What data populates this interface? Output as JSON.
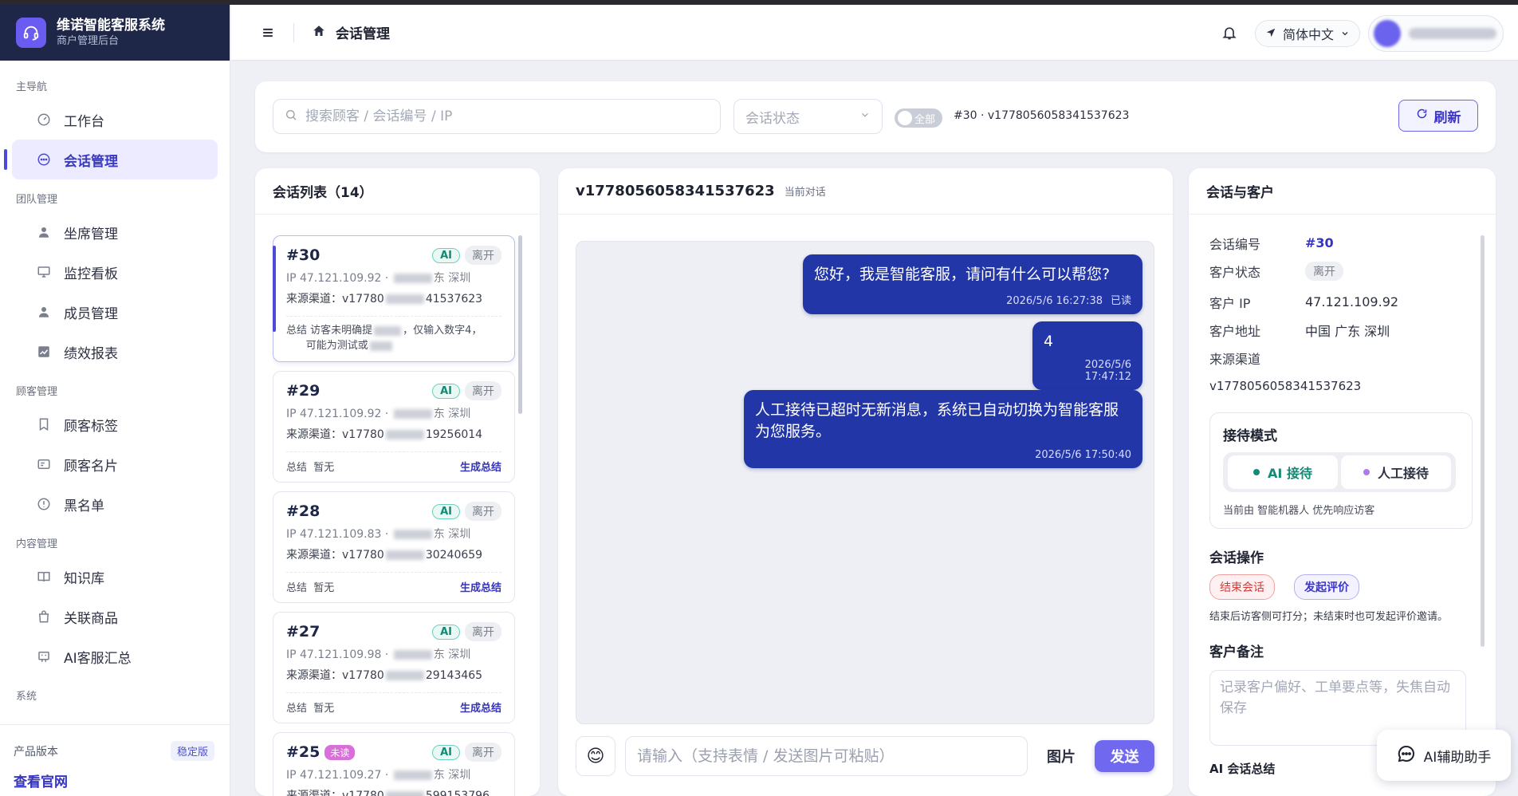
{
  "brand": {
    "name": "维诺智能客服系统",
    "subtitle": "商户管理后台"
  },
  "sidebar": {
    "groups": [
      {
        "label": "主导航",
        "items": [
          {
            "label": "工作台",
            "icon": "dashboard-icon"
          },
          {
            "label": "会话管理",
            "icon": "chat-icon",
            "active": true
          }
        ]
      },
      {
        "label": "团队管理",
        "items": [
          {
            "label": "坐席管理",
            "icon": "user-icon"
          },
          {
            "label": "监控看板",
            "icon": "monitor-icon"
          },
          {
            "label": "成员管理",
            "icon": "user-icon"
          },
          {
            "label": "绩效报表",
            "icon": "chart-icon"
          }
        ]
      },
      {
        "label": "顾客管理",
        "items": [
          {
            "label": "顾客标签",
            "icon": "bookmark-icon"
          },
          {
            "label": "顾客名片",
            "icon": "card-icon"
          },
          {
            "label": "黑名单",
            "icon": "block-icon"
          }
        ]
      },
      {
        "label": "内容管理",
        "items": [
          {
            "label": "知识库",
            "icon": "book-icon"
          },
          {
            "label": "关联商品",
            "icon": "bag-icon"
          },
          {
            "label": "AI客服汇总",
            "icon": "bot-icon"
          }
        ]
      },
      {
        "label": "系统",
        "items": []
      }
    ],
    "footer": {
      "version_label": "产品版本",
      "version_badge": "稳定版",
      "site_link": "查看官网"
    }
  },
  "topbar": {
    "title": "会话管理",
    "language": "简体中文"
  },
  "filters": {
    "search_placeholder": "搜索顾客 / 会话编号 / IP",
    "status_placeholder": "会话状态",
    "toggle_label": "全部",
    "current_session": "#30 · v1778056058341537623",
    "refresh_label": "刷新"
  },
  "session_list": {
    "title": "会话列表（14）",
    "items": [
      {
        "no": "#30",
        "ai": "AI",
        "status": "离开",
        "unread": "",
        "ip_prefix": "IP 47.121.109.92 · ",
        "city": "东 深圳",
        "channel_prefix": "来源渠道：v17780",
        "channel_suffix": "41537623",
        "summary_label": "总结",
        "summary_a": "访客未明确提",
        "summary_b": "，仅输入数字4，",
        "summary_c": "可能为测试或",
        "generate": ""
      },
      {
        "no": "#29",
        "ai": "AI",
        "status": "离开",
        "unread": "",
        "ip_prefix": "IP 47.121.109.92 · ",
        "city": "东 深圳",
        "channel_prefix": "来源渠道：v17780",
        "channel_suffix": "19256014",
        "summary_label": "总结",
        "summary_a": "暂无",
        "generate": "生成总结"
      },
      {
        "no": "#28",
        "ai": "AI",
        "status": "离开",
        "unread": "",
        "ip_prefix": "IP 47.121.109.83 · ",
        "city": "东 深圳",
        "channel_prefix": "来源渠道：v17780",
        "channel_suffix": "30240659",
        "summary_label": "总结",
        "summary_a": "暂无",
        "generate": "生成总结"
      },
      {
        "no": "#27",
        "ai": "AI",
        "status": "离开",
        "unread": "",
        "ip_prefix": "IP 47.121.109.98 · ",
        "city": "东 深圳",
        "channel_prefix": "来源渠道：v17780",
        "channel_suffix": "29143465",
        "summary_label": "总结",
        "summary_a": "暂无",
        "generate": "生成总结"
      },
      {
        "no": "#25",
        "ai": "AI",
        "status": "离开",
        "unread": "未读",
        "ip_prefix": "IP 47.121.109.27 · ",
        "city": "东 深圳",
        "channel_prefix": "来源渠道：v17780",
        "channel_suffix": "599153796",
        "summary_label": "",
        "summary_a": "",
        "generate": ""
      }
    ]
  },
  "chat": {
    "title": "v1778056058341537623",
    "subtitle": "当前对话",
    "messages": [
      {
        "text": "您好，我是智能客服，请问有什么可以帮您?",
        "time": "2026/5/6 16:27:38",
        "read": "已读"
      },
      {
        "text": "4",
        "time": "2026/5/6 17:47:12",
        "read": ""
      },
      {
        "text": "人工接待已超时无新消息，系统已自动切换为智能客服为您服务。",
        "time": "2026/5/6 17:50:40",
        "read": ""
      }
    ],
    "input_placeholder": "请输入（支持表情 / 发送图片可粘贴）",
    "image_label": "图片",
    "send_label": "发送"
  },
  "info": {
    "title": "会话与客户",
    "fields": {
      "session_no_label": "会话编号",
      "session_no": "#30",
      "status_label": "客户状态",
      "status": "离开",
      "ip_label": "客户 IP",
      "ip": "47.121.109.92",
      "address_label": "客户地址",
      "address": "中国 广东 深圳",
      "channel_label": "来源渠道",
      "channel": "v1778056058341537623"
    },
    "mode": {
      "title": "接待模式",
      "ai_label": "AI 接待",
      "human_label": "人工接待",
      "note": "当前由 智能机器人 优先响应访客"
    },
    "ops": {
      "title": "会话操作",
      "end_label": "结束会话",
      "rate_label": "发起评价",
      "note": "结束后访客侧可打分；未结束时也可发起评价邀请。"
    },
    "remark": {
      "title": "客户备注",
      "placeholder": "记录客户偏好、工单要点等，失焦自动保存"
    },
    "ai_summary_title": "AI 会话总结"
  },
  "assistant": {
    "label": "AI辅助助手"
  },
  "colors": {
    "brand_dark": "#1f2748",
    "accent": "#4b4bd8",
    "bubble": "#2236a8",
    "ai_green": "#128a74",
    "danger": "#d23a3a"
  }
}
